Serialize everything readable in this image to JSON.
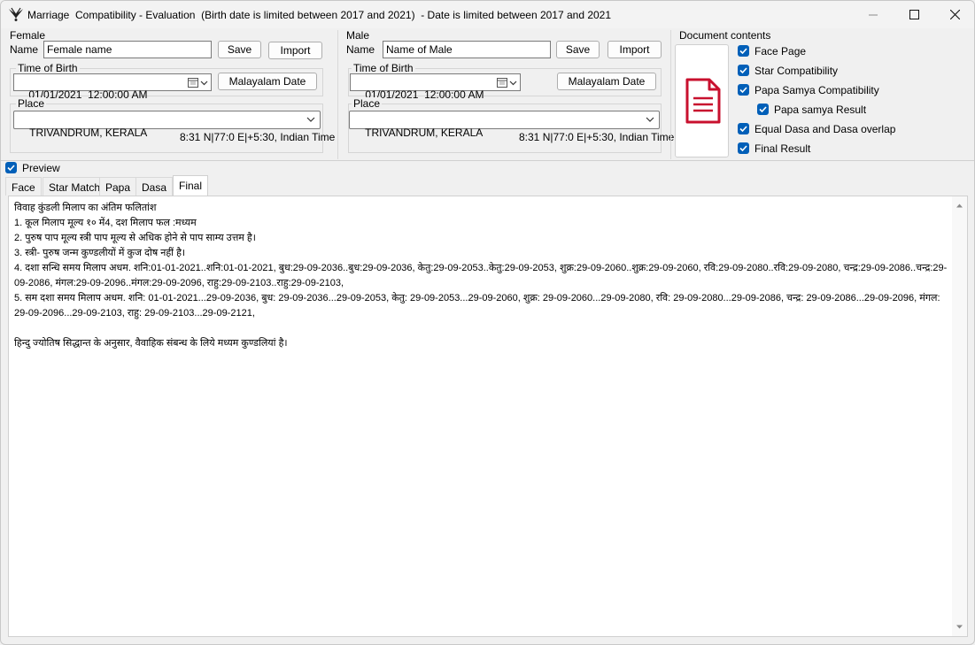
{
  "window": {
    "title": "Marriage  Compatibility - Evaluation  (Birth date is limited between 2017 and 2021)  - Date is limited between 2017 and 2021"
  },
  "female": {
    "group_label": "Female",
    "name_label": "Name",
    "name_value": "Female name",
    "save_label": "Save",
    "import_label": "Import",
    "tob_label": "Time of Birth",
    "tob_value": "01/01/2021  12:00:00 AM",
    "malayalam_date_label": "Malayalam Date",
    "place_label": "Place",
    "place_value": "TRIVANDRUM, KERALA",
    "coords": "8:31 N|77:0 E|+5:30, Indian Time"
  },
  "male": {
    "group_label": "Male",
    "name_label": "Name",
    "name_value": "Name of Male",
    "save_label": "Save",
    "import_label": "Import",
    "tob_label": "Time of Birth",
    "tob_value": "01/01/2021  12:00:00 AM",
    "malayalam_date_label": "Malayalam Date",
    "place_label": "Place",
    "place_value": "TRIVANDRUM, KERALA",
    "coords": "8:31 N|77:0 E|+5:30, Indian Time"
  },
  "document_contents": {
    "label": "Document contents",
    "items": [
      {
        "label": "Face Page",
        "checked": true
      },
      {
        "label": "Star Compatibility",
        "checked": true
      },
      {
        "label": "Papa Samya Compatibility",
        "checked": true
      },
      {
        "label": "Papa samya Result",
        "checked": true
      },
      {
        "label": "Equal Dasa and Dasa overlap",
        "checked": true
      },
      {
        "label": "Final Result",
        "checked": true
      }
    ],
    "icon": "document-icon",
    "icon_color": "#c8102e"
  },
  "preview": {
    "label": "Preview",
    "checked": true
  },
  "tabs": [
    {
      "label": "Face"
    },
    {
      "label": "Star Match"
    },
    {
      "label": "Papa"
    },
    {
      "label": "Dasa"
    },
    {
      "label": "Final",
      "active": true
    }
  ],
  "final_result": {
    "lines": [
      "विवाह कुंडली मिलाप का अंतिम फलितांश",
      "1. कूल मिलाप मूल्य १० में4, दश मिलाप फल :मध्यम",
      "2. पुरुष पाप मूल्य स्त्री पाप मूल्य से अधिक होने से पाप साम्य उत्तम है।",
      "3. स्त्री- पुरुष जन्म कुण्डलीयों में कुज दोष नहीं है।",
      "4. दशा सन्धि समय मिलाप अधम. शनि:01-01-2021..शनि:01-01-2021, बुध:29-09-2036..बुध:29-09-2036, केतु:29-09-2053..केतु:29-09-2053, शुक्र:29-09-2060..शुक्र:29-09-2060, रवि:29-09-2080..रवि:29-09-2080, चन्द्र:29-09-2086..चन्द्र:29-09-2086, मंगल:29-09-2096..मंगल:29-09-2096, राहु:29-09-2103..राहु:29-09-2103,",
      "5. सम दशा समय मिलाप अधम. शनि: 01-01-2021...29-09-2036, बुध: 29-09-2036...29-09-2053, केतु: 29-09-2053...29-09-2060, शुक्र: 29-09-2060...29-09-2080, रवि: 29-09-2080...29-09-2086, चन्द्र: 29-09-2086...29-09-2096, मंगल: 29-09-2096...29-09-2103, राहु: 29-09-2103...29-09-2121,",
      "",
      "हिन्दु ज्योतिष सिद्धान्त के अनुसार, वैवाहिक संबन्ध के लिये मध्यम कुण्डलियां है।"
    ]
  },
  "colors": {
    "accent": "#005fb8"
  }
}
